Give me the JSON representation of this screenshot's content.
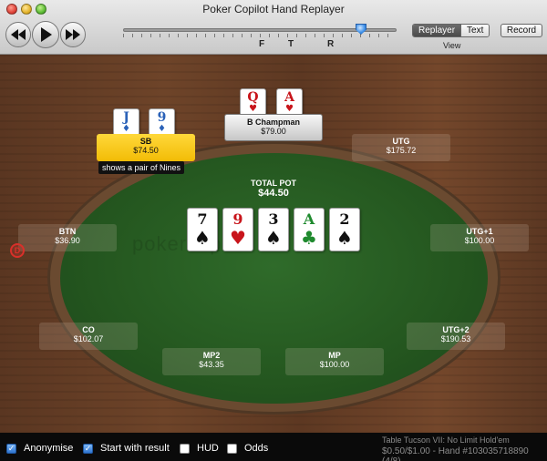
{
  "window": {
    "title": "Poker Copilot Hand Replayer"
  },
  "toolbar": {
    "rewind_icon": "rewind-icon",
    "play_icon": "play-icon",
    "ffwd_icon": "fast-forward-icon",
    "streets": [
      "F",
      "T",
      "R"
    ],
    "view_tabs": [
      "Replayer",
      "Text"
    ],
    "active_view": "Replayer",
    "view_label": "View",
    "record_label": "Record"
  },
  "table": {
    "pot_label": "TOTAL POT",
    "pot_value": "$44.50",
    "watermark": "pokercopilot",
    "board": [
      {
        "rank": "7",
        "suit": "♠",
        "color": "black"
      },
      {
        "rank": "9",
        "suit": "♥",
        "color": "red"
      },
      {
        "rank": "3",
        "suit": "♠",
        "color": "black"
      },
      {
        "rank": "A",
        "suit": "♣",
        "color": "green"
      },
      {
        "rank": "2",
        "suit": "♠",
        "color": "black"
      }
    ],
    "dealer_button": "D"
  },
  "seats": {
    "sb": {
      "name": "SB",
      "stack": "$74.50",
      "note": "shows a pair of Nines",
      "cards": [
        {
          "rank": "J",
          "suit": "♦",
          "color": "blue"
        },
        {
          "rank": "9",
          "suit": "♦",
          "color": "blue"
        }
      ]
    },
    "hero": {
      "name": "B Champman",
      "stack": "$79.00",
      "cards": [
        {
          "rank": "Q",
          "suit": "♥",
          "color": "red"
        },
        {
          "rank": "A",
          "suit": "♥",
          "color": "red"
        }
      ]
    },
    "utg": {
      "name": "UTG",
      "stack": "$175.72"
    },
    "utg1": {
      "name": "UTG+1",
      "stack": "$100.00"
    },
    "utg2": {
      "name": "UTG+2",
      "stack": "$190.53"
    },
    "mp": {
      "name": "MP",
      "stack": "$100.00"
    },
    "mp2": {
      "name": "MP2",
      "stack": "$43.35"
    },
    "co": {
      "name": "CO",
      "stack": "$102.07"
    },
    "btn": {
      "name": "BTN",
      "stack": "$36.90"
    }
  },
  "options": {
    "anonymise": {
      "label": "Anonymise",
      "checked": true
    },
    "start_with_result": {
      "label": "Start with result",
      "checked": true
    },
    "hud": {
      "label": "HUD",
      "checked": false
    },
    "odds": {
      "label": "Odds",
      "checked": false
    }
  },
  "footer": {
    "table_info": "Table Tucson VII: No Limit Hold'em",
    "hand_info": "$0.50/$1.00 - Hand #103035718890 (4/8)"
  },
  "colors": {
    "felt": "#2f6b2a",
    "sb_highlight": "#f2bc06",
    "wood": "#6e4429"
  }
}
